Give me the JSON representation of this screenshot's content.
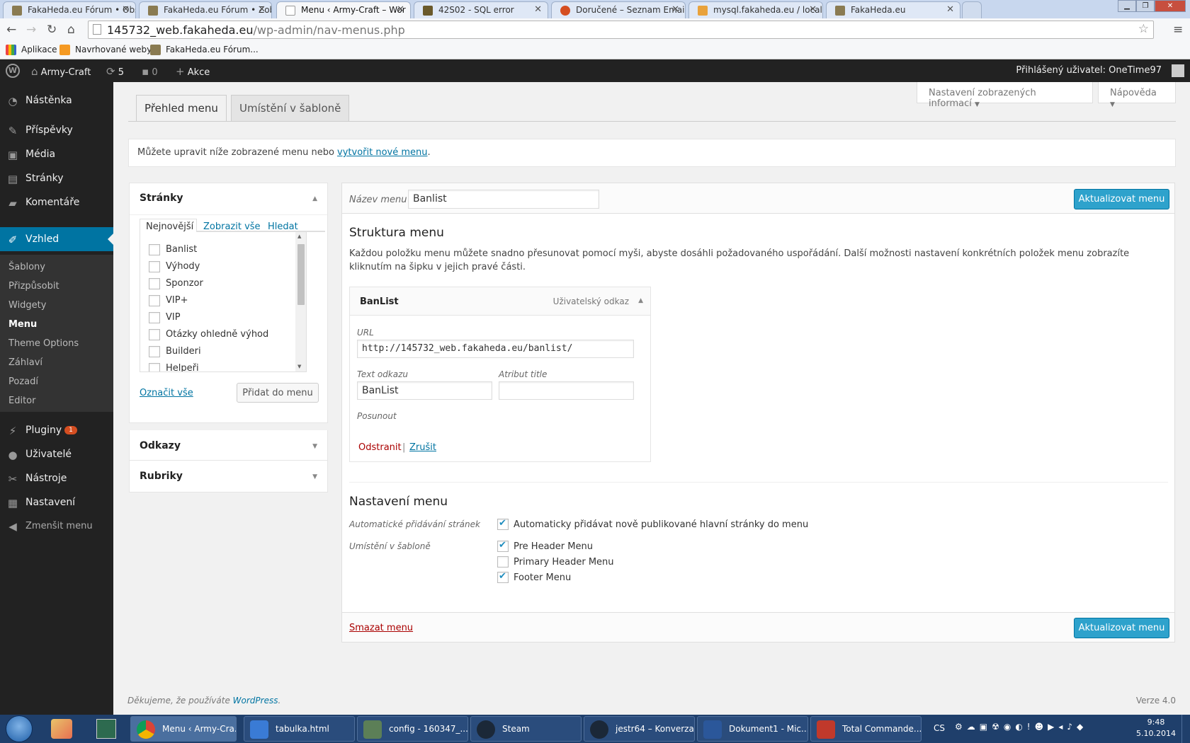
{
  "browser": {
    "tabs": [
      {
        "title": "FakaHeda.eu Fórum • Obs",
        "active": false
      },
      {
        "title": "FakaHeda.eu Fórum • Zob",
        "active": false
      },
      {
        "title": "Menu ‹ Army-Craft – Wor",
        "active": true
      },
      {
        "title": "42S02 - SQL error",
        "active": false
      },
      {
        "title": "Doručené – Seznam Email",
        "active": false
      },
      {
        "title": "mysql.fakaheda.eu / locall",
        "active": false
      },
      {
        "title": "FakaHeda.eu",
        "active": false
      }
    ],
    "url_host": "145732_web.fakaheda.eu",
    "url_path": "/wp-admin/nav-menus.php",
    "bookmarks": [
      "Aplikace",
      "Navrhované weby",
      "FakaHeda.eu Fórum..."
    ]
  },
  "adminbar": {
    "site_name": "Army-Craft",
    "updates_count": "5",
    "comments_count": "0",
    "new_label": "Akce",
    "account_label": "Přihlášený uživatel: OneTime97"
  },
  "sidebar": {
    "items": [
      {
        "label": "Nástěnka",
        "icon": "dashboard-icon"
      },
      {
        "label": "Příspěvky",
        "icon": "pin-icon"
      },
      {
        "label": "Média",
        "icon": "media-icon"
      },
      {
        "label": "Stránky",
        "icon": "pages-icon"
      },
      {
        "label": "Komentáře",
        "icon": "comment-icon"
      },
      {
        "label": "Vzhled",
        "icon": "brush-icon"
      },
      {
        "label": "Pluginy",
        "icon": "plugin-icon",
        "badge": "1"
      },
      {
        "label": "Uživatelé",
        "icon": "user-icon"
      },
      {
        "label": "Nástroje",
        "icon": "wrench-icon"
      },
      {
        "label": "Nastavení",
        "icon": "settings-icon"
      },
      {
        "label": "Zmenšit menu",
        "icon": "collapse-icon"
      }
    ],
    "submenu": [
      "Šablony",
      "Přizpůsobit",
      "Widgety",
      "Menu",
      "Theme Options",
      "Záhlaví",
      "Pozadí",
      "Editor"
    ]
  },
  "screen_meta": {
    "options_label": "Nastavení zobrazených informací",
    "help_label": "Nápověda"
  },
  "nav_tabs": [
    "Přehled menu",
    "Umístění v šabloně"
  ],
  "notice": {
    "text": "Můžete upravit níže zobrazené menu nebo ",
    "link": "vytvořit nové menu",
    "after": "."
  },
  "left_panel": {
    "pages_title": "Stránky",
    "tabs": [
      "Nejnovější",
      "Zobrazit vše",
      "Hledat"
    ],
    "pages": [
      "Banlist",
      "Výhody",
      "Sponzor",
      "VIP+",
      "VIP",
      "Otázky ohledně výhod",
      "Builderi",
      "Helpeři"
    ],
    "select_all": "Označit vše",
    "add_button": "Přidat do menu",
    "links_title": "Odkazy",
    "categories_title": "Rubriky"
  },
  "menu_editor": {
    "name_label": "Název menu",
    "name_value": "Banlist",
    "save_button": "Aktualizovat menu",
    "structure_title": "Struktura menu",
    "structure_desc": "Každou položku menu můžete snadno přesunovat pomocí myši, abyste dosáhli požadovaného uspořádání. Další možnosti nastavení konkrétních položek menu zobrazíte kliknutím na šipku v jejich pravé části.",
    "item": {
      "title": "BanList",
      "type": "Uživatelský odkaz",
      "url_label": "URL",
      "url_value": "http://145732_web.fakaheda.eu/banlist/",
      "text_label": "Text odkazu",
      "text_value": "BanList",
      "title_attr_label": "Atribut title",
      "title_attr_value": "",
      "move_label": "Posunout",
      "remove": "Odstranit",
      "separator": "|",
      "cancel": "Zrušit"
    },
    "settings_title": "Nastavení menu",
    "auto_add_label": "Automatické přidávání stránek",
    "auto_add_option": "Automaticky přidávat nově publikované hlavní stránky do menu",
    "location_label": "Umístění v šabloně",
    "locations": [
      {
        "label": "Pre Header Menu",
        "checked": true
      },
      {
        "label": "Primary Header Menu",
        "checked": false
      },
      {
        "label": "Footer Menu",
        "checked": true
      }
    ],
    "delete_link": "Smazat menu"
  },
  "footer": {
    "thanks": "Děkujeme, že používáte ",
    "wp_link": "WordPress",
    "after": ".",
    "version": "Verze 4.0"
  },
  "taskbar": {
    "items": [
      "Menu ‹ Army-Cra...",
      "tabulka.html",
      "config - 160347_...",
      "Steam",
      "jestr64 – Konverza...",
      "Dokument1 - Mic...",
      "Total Commande..."
    ],
    "lang": "CS",
    "time": "9:48",
    "date": "5.10.2014"
  }
}
